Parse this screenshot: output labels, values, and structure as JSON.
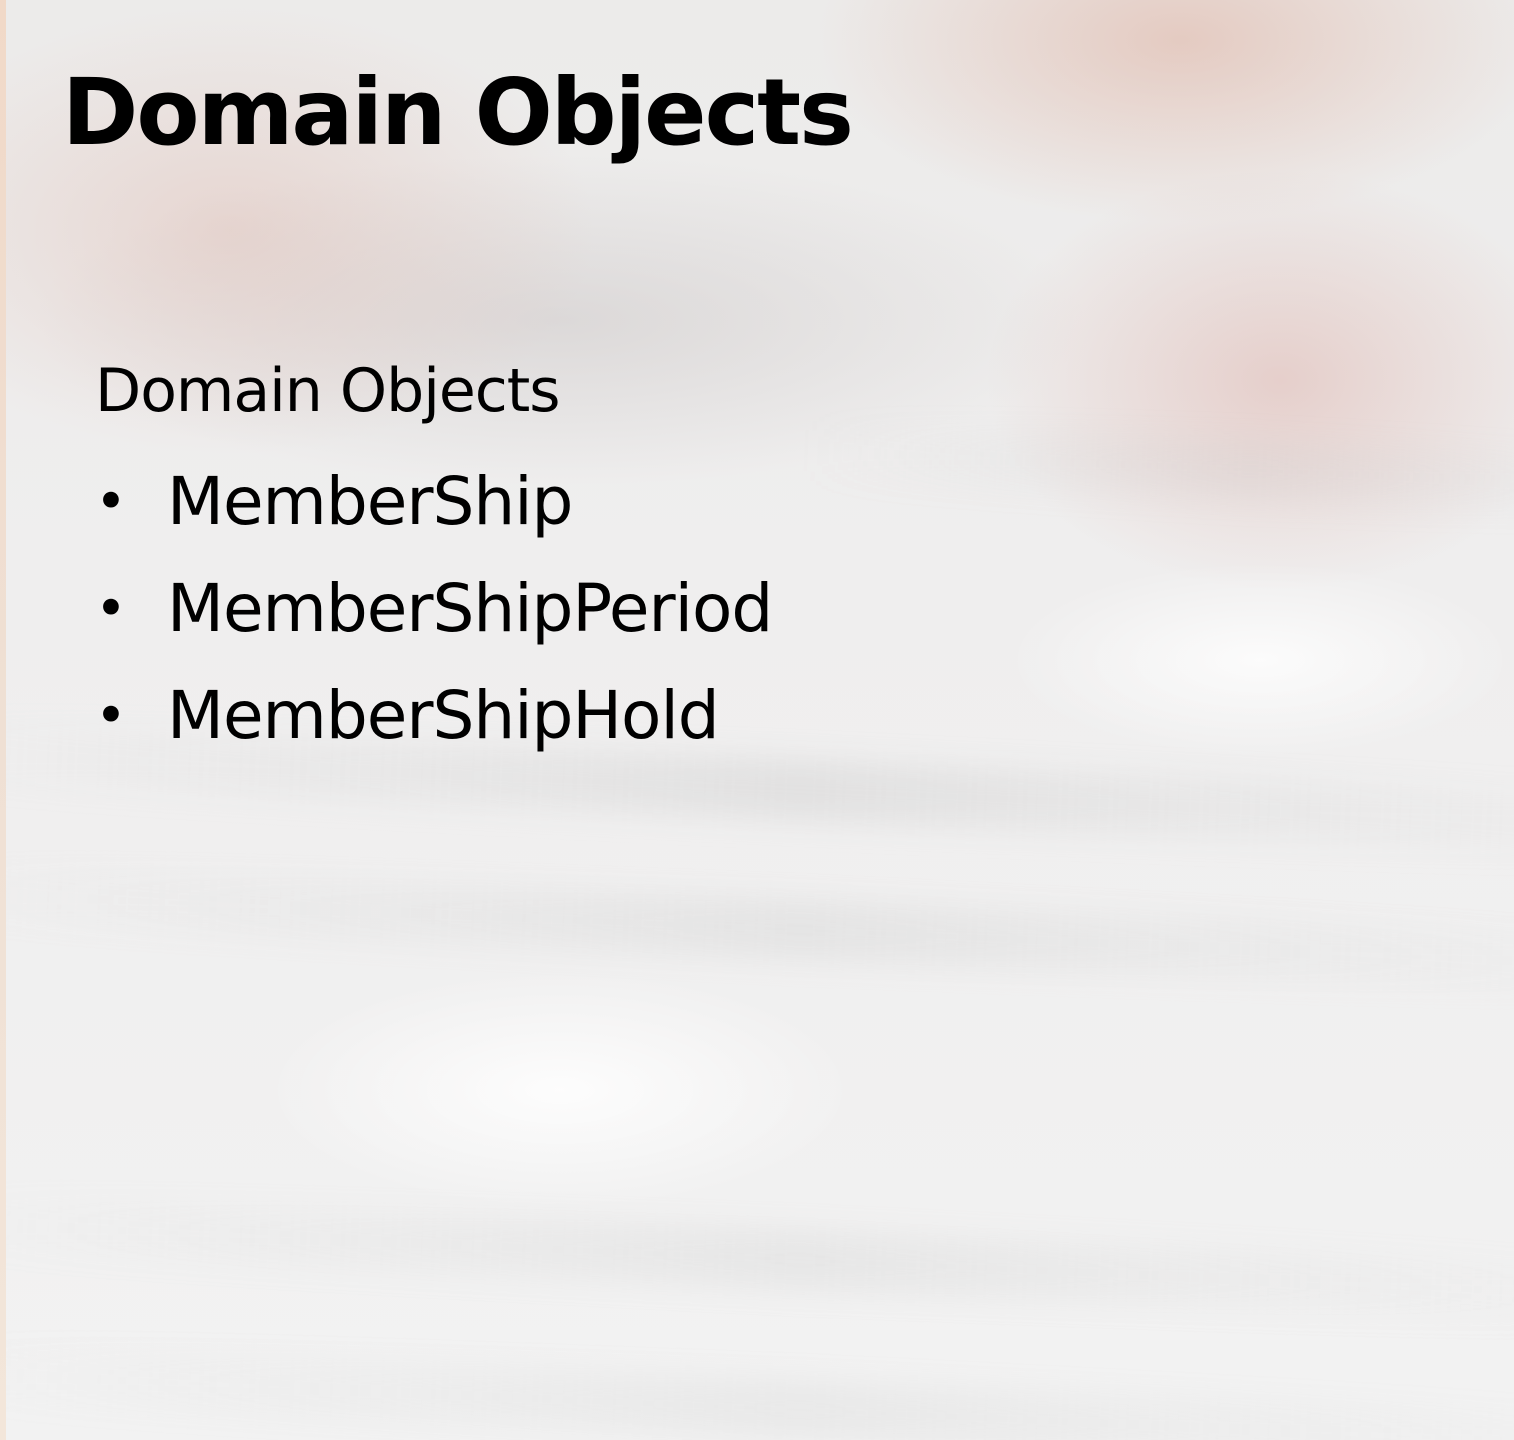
{
  "slide": {
    "title": "Domain Objects",
    "body_heading": "Domain Objects",
    "bullet_glyph": "•",
    "bullets": [
      "MemberShip",
      "MemberShipPeriod",
      "MemberShipHold"
    ]
  },
  "colors": {
    "text": "#000000",
    "background": "#f3f2f2"
  }
}
